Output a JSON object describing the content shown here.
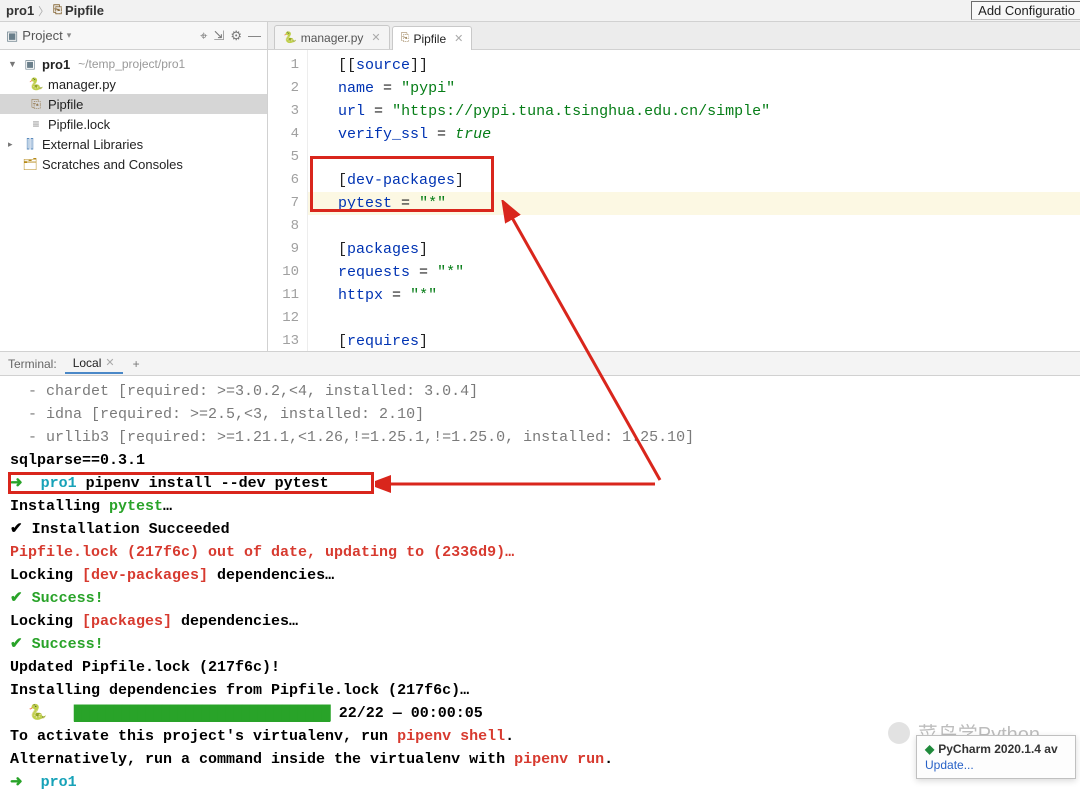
{
  "breadcrumb": {
    "root": "pro1",
    "file": "Pipfile"
  },
  "toolbar": {
    "add_config": "Add Configuratio"
  },
  "project_pane": {
    "title": "Project",
    "root": {
      "name": "pro1",
      "path": "~/temp_project/pro1"
    },
    "items": [
      {
        "name": "manager.py"
      },
      {
        "name": "Pipfile"
      },
      {
        "name": "Pipfile.lock"
      }
    ],
    "external": "External Libraries",
    "scratches": "Scratches and Consoles"
  },
  "tabs": [
    {
      "label": "manager.py",
      "active": false
    },
    {
      "label": "Pipfile",
      "active": true
    }
  ],
  "editor": {
    "lines": [
      "[[source]]",
      "name = \"pypi\"",
      "url = \"https://pypi.tuna.tsinghua.edu.cn/simple\"",
      "verify_ssl = true",
      "",
      "[dev-packages]",
      "pytest = \"*\"",
      "",
      "[packages]",
      "requests = \"*\"",
      "httpx = \"*\"",
      "",
      "[requires]"
    ],
    "highlight_line": 7
  },
  "terminal": {
    "label": "Terminal:",
    "tab": "Local",
    "lines": [
      {
        "segs": [
          {
            "t": "  - chardet [required: >=3.0.2,<4, installed: 3.0.4]",
            "c": "grey"
          }
        ]
      },
      {
        "segs": [
          {
            "t": "  - idna [required: >=2.5,<3, installed: 2.10]",
            "c": "grey"
          }
        ]
      },
      {
        "segs": [
          {
            "t": "  - urllib3 [required: >=1.21.1,<1.26,!=1.25.1,!=1.25.0, installed: 1.25.10]",
            "c": "grey"
          }
        ]
      },
      {
        "segs": [
          {
            "t": "sqlparse==0.3.1",
            "c": "blk"
          }
        ]
      },
      {
        "segs": [
          {
            "t": "➜  ",
            "c": "green"
          },
          {
            "t": "pro1 ",
            "c": "cyan"
          },
          {
            "t": "pipenv install --dev pytest",
            "c": "blk"
          }
        ]
      },
      {
        "segs": [
          {
            "t": "Installing ",
            "c": "blk"
          },
          {
            "t": "pytest",
            "c": "green"
          },
          {
            "t": "…",
            "c": "blk"
          }
        ]
      },
      {
        "segs": [
          {
            "t": "✔ Installation Succeeded",
            "c": "blk"
          }
        ]
      },
      {
        "segs": [
          {
            "t": "Pipfile.lock (217f6c) out of date, updating to (2336d9)…",
            "c": "red"
          }
        ]
      },
      {
        "segs": [
          {
            "t": "Locking ",
            "c": "blk"
          },
          {
            "t": "[dev-packages]",
            "c": "red"
          },
          {
            "t": " dependencies…",
            "c": "blk"
          }
        ]
      },
      {
        "segs": [
          {
            "t": "✔ Success!",
            "c": "green"
          }
        ]
      },
      {
        "segs": [
          {
            "t": "Locking ",
            "c": "blk"
          },
          {
            "t": "[packages]",
            "c": "red"
          },
          {
            "t": " dependencies…",
            "c": "blk"
          }
        ]
      },
      {
        "segs": [
          {
            "t": "✔ Success!",
            "c": "green"
          }
        ]
      },
      {
        "segs": [
          {
            "t": "Updated Pipfile.lock (217f6c)!",
            "c": "blk"
          }
        ]
      },
      {
        "segs": [
          {
            "t": "Installing dependencies from Pipfile.lock (217f6c)…",
            "c": "blk"
          }
        ]
      },
      {
        "segs": [
          {
            "t": "  🐍   ",
            "c": "blk"
          },
          {
            "t": "████████████████████████████████",
            "c": "prog"
          },
          {
            "t": " 22/22 — 00:00:05",
            "c": "blk"
          }
        ]
      },
      {
        "segs": [
          {
            "t": "To activate this project's virtualenv, run ",
            "c": "blk"
          },
          {
            "t": "pipenv shell",
            "c": "red"
          },
          {
            "t": ".",
            "c": "blk"
          }
        ]
      },
      {
        "segs": [
          {
            "t": "Alternatively, run a command inside the virtualenv with ",
            "c": "blk"
          },
          {
            "t": "pipenv run",
            "c": "red"
          },
          {
            "t": ".",
            "c": "blk"
          }
        ]
      },
      {
        "segs": [
          {
            "t": "➜  ",
            "c": "green"
          },
          {
            "t": "pro1",
            "c": "cyan"
          }
        ]
      }
    ]
  },
  "status_popup": {
    "title": "PyCharm 2020.1.4 av",
    "link": "Update..."
  },
  "watermark": "菜鸟学Python"
}
